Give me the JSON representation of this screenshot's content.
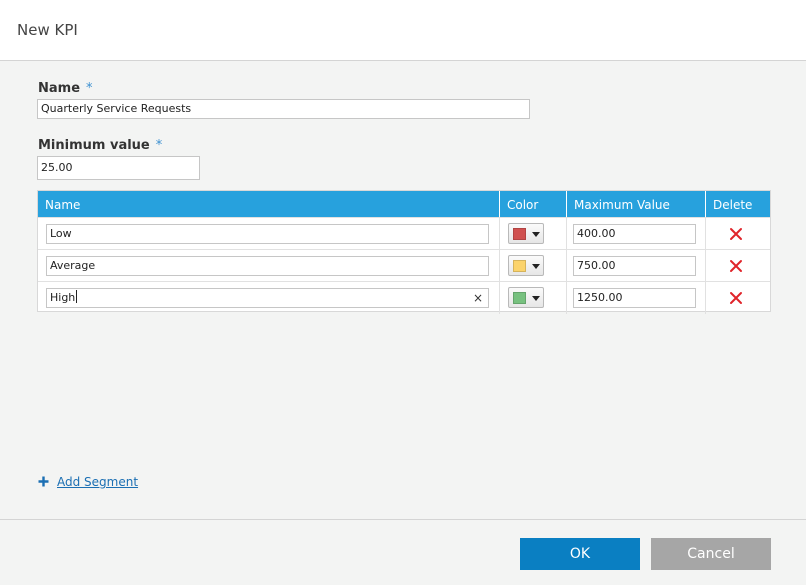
{
  "dialog": {
    "title": "New KPI"
  },
  "form": {
    "name_label": "Name",
    "required_mark": "*",
    "name_value": "Quarterly Service Requests",
    "min_label": "Minimum value",
    "min_value": "25.00"
  },
  "segments": {
    "headers": {
      "name": "Name",
      "color": "Color",
      "max": "Maximum Value",
      "delete": "Delete"
    },
    "rows": [
      {
        "name": "Low",
        "color": "#d0504f",
        "max": "400.00"
      },
      {
        "name": "Average",
        "color": "#fbd36b",
        "max": "750.00"
      },
      {
        "name": "High",
        "color": "#77c17f",
        "max": "1250.00"
      }
    ],
    "clear_glyph": "×",
    "icons": {
      "delete": "delete-x-icon",
      "dropdown": "chevron-down-icon",
      "add": "plus-icon"
    }
  },
  "add_segment": {
    "label": "Add Segment"
  },
  "footer": {
    "ok_label": "OK",
    "cancel_label": "Cancel"
  },
  "colors": {
    "accent": "#27a1dd",
    "ok": "#0a7fc2",
    "cancel": "#a6a6a6",
    "delete": "#e0242a"
  }
}
